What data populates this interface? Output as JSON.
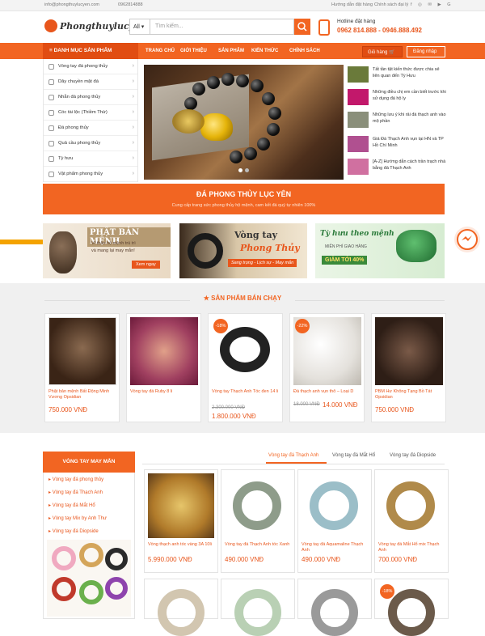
{
  "topbar": {
    "email": "info@phongthuylucyen.com",
    "phone": "0962814888",
    "guide_link": "Hướng dẫn đặt hàng",
    "agent_link": "Chính sách đại lý"
  },
  "header": {
    "logo_text": "Phongthuylucyen",
    "search_category": "All",
    "search_placeholder": "Tìm kiếm...",
    "hotline_label": "Hotline đặt hàng",
    "hotline_numbers": "0962 814.888 - 0946.888.492"
  },
  "nav": {
    "category_button": "DANH MỤC SẢN PHẨM",
    "items": [
      "TRANG CHỦ",
      "GIỚI THIỆU",
      "SẢN PHẨM",
      "KIẾN THỨC",
      "CHÍNH SÁCH"
    ],
    "cart": "Giỏ hàng",
    "login": "Đăng nhập"
  },
  "sidebar": {
    "items": [
      {
        "label": "Vòng tay đá phong thủy"
      },
      {
        "label": "Dây chuyền mặt đá"
      },
      {
        "label": "Nhẫn đá phong thủy"
      },
      {
        "label": "Cóc tài lộc (Thiềm Thừ)"
      },
      {
        "label": "Đá phong thủy"
      },
      {
        "label": "Quả cầu phong thủy"
      },
      {
        "label": "Tỳ hưu"
      },
      {
        "label": "Vật phẩm phong thủy"
      }
    ]
  },
  "news": [
    {
      "title": "Tất tần tật kiến thức được chia sẻ liên quan đến Tỳ Hưu",
      "color": "#6a7a3a"
    },
    {
      "title": "Những điều chị em cần biết trước khi sử dụng đá hộ ly",
      "color": "#c2186b"
    },
    {
      "title": "Những lưu ý khi rải đá thạch anh vào mộ phần",
      "color": "#8a8f7a"
    },
    {
      "title": "Giá Đá Thạch Anh vụn tại HN và TP Hồ Chí Minh",
      "color": "#b05090"
    },
    {
      "title": "[A-Z] Hướng dẫn cách trần trạch nhà bằng đá Thạch Anh",
      "color": "#d070a0"
    }
  ],
  "banner": {
    "title": "ĐÁ PHONG THỦY LỤC YÊN",
    "subtitle": "Cung cấp trang sức phong thủy hộ mệnh, cam kết đá quý tự nhiên 100%"
  },
  "promos": [
    {
      "title": "PHẬT BẢN MỆNH",
      "line1": "Vì thân hộ mệnh trú trì",
      "line2": "và mang lại may mắn!",
      "cta": "Xem ngay"
    },
    {
      "title": "Vòng tay",
      "title2": "Phong Thủy",
      "line1": "Sang trọng - Lịch sự - May mắn"
    },
    {
      "title": "Tỳ hưu theo mệnh",
      "line1": "MIỄN PHÍ GIAO HÀNG",
      "line2": "GIẢM TỚI 40%"
    }
  ],
  "bestsellers": {
    "title": "SẢN PHẨM BÁN CHẠY",
    "items": [
      {
        "name": "Phật bản mệnh Bất Động Minh Vương Opsidian",
        "price": "750.000 VNĐ",
        "old_price": "",
        "badge": ""
      },
      {
        "name": "Vòng tay đá Ruby 8 li",
        "price": "",
        "old_price": "",
        "badge": ""
      },
      {
        "name": "Vòng tay Thạch Anh Tóc đen 14 li",
        "price": "1.800.000 VNĐ",
        "old_price": "2.300.000 VNĐ",
        "badge": "-18%"
      },
      {
        "name": "Đá thạch anh vụn thô – Loại D",
        "price": "14.000 VNĐ",
        "old_price": "18.000 VNĐ",
        "badge": "-22%"
      },
      {
        "name": "PBM Hư Không Tạng Bồ Tát Opsidian",
        "price": "750.000 VNĐ",
        "old_price": "",
        "badge": ""
      }
    ]
  },
  "lucky": {
    "title": "VÒNG TAY MAY MẮN",
    "items": [
      "Vòng tay đá phong thủy",
      "Vòng tay đá Thạch Anh",
      "Vòng tay đá Mắt Hổ",
      "Vòng tay Mix by Anh Thư",
      "Vòng tay đá Diopside"
    ],
    "tabs": [
      "Vòng tay đá Thạch Anh",
      "Vòng tay đá Mắt Hổ",
      "Vòng tay đá Diopside"
    ],
    "products": [
      {
        "name": "Vòng thạch anh tóc vàng 3A 10li",
        "price": "5.990.000 VNĐ"
      },
      {
        "name": "Vòng tay đá Thạch Anh tóc Xanh",
        "price": "490.000 VNĐ"
      },
      {
        "name": "Vòng tay đá Aquamaline Thạch Anh",
        "price": "490.000 VNĐ"
      },
      {
        "name": "Vòng tay đá Mắt Hổ mix Thạch Anh",
        "price": "700.000 VNĐ"
      }
    ],
    "row2_badge": "-18%"
  }
}
